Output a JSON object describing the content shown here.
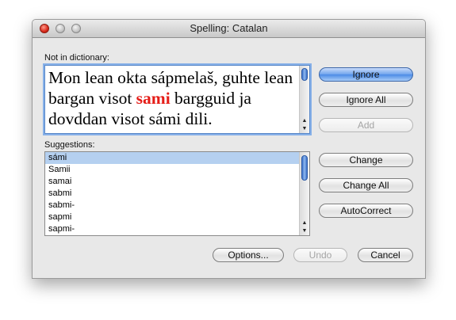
{
  "window": {
    "title": "Spelling: Catalan"
  },
  "not_in_dictionary": {
    "label": "Not in dictionary:",
    "text_before": "Mon lean okta sápmelaš, guhte lean bargan visot ",
    "misspelled_word": "sami",
    "text_after": " bargguid ja dovddan visot sámi dili."
  },
  "suggestions": {
    "label": "Suggestions:",
    "items": [
      "sámi",
      "Samii",
      "samai",
      "sabmi",
      "sabmi-",
      "sapmi",
      "sapmi-"
    ],
    "selected_index": 0
  },
  "buttons": {
    "ignore": "Ignore",
    "ignore_all": "Ignore All",
    "add": "Add",
    "change": "Change",
    "change_all": "Change All",
    "autocorrect": "AutoCorrect",
    "options": "Options...",
    "undo": "Undo",
    "cancel": "Cancel"
  },
  "icons": {
    "scroll_up": "▲",
    "scroll_down": "▼"
  },
  "colors": {
    "misspelled": "#e51c17",
    "selection": "#b5d0f0",
    "default_button": "#4b8ae6"
  }
}
